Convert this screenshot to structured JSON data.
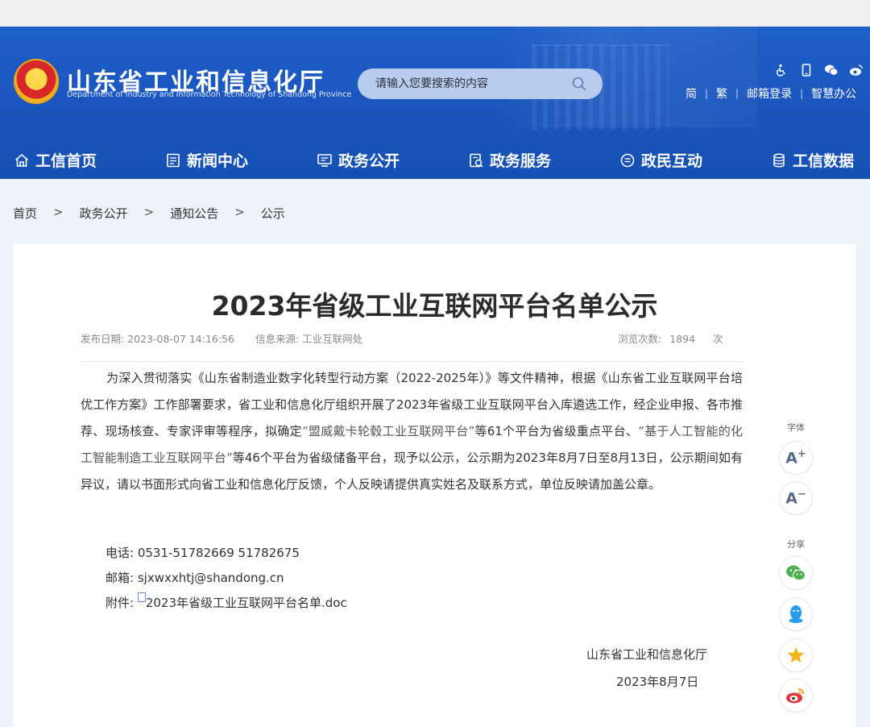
{
  "header": {
    "site_name": "山东省工业和信息化厅",
    "site_name_en": "Department of Industry and Information Technology of Shandong Province",
    "search_placeholder": "请输入您要搜索的内容",
    "links": [
      "简",
      "繁",
      "邮箱登录",
      "智慧办公"
    ],
    "tool_icons": [
      "accessibility-icon",
      "mobile-icon",
      "wechat-icon",
      "weibo-icon"
    ]
  },
  "nav": {
    "items": [
      {
        "label": "工信首页",
        "icon": "home-icon"
      },
      {
        "label": "新闻中心",
        "icon": "news-icon"
      },
      {
        "label": "政务公开",
        "icon": "gov-open-icon"
      },
      {
        "label": "政务服务",
        "icon": "service-icon"
      },
      {
        "label": "政民互动",
        "icon": "interaction-icon"
      },
      {
        "label": "工信数据",
        "icon": "database-icon"
      }
    ]
  },
  "breadcrumb": {
    "items": [
      "首页",
      "政务公开",
      "通知公告",
      "公示"
    ],
    "separator": ">"
  },
  "article": {
    "title": "2023年省级工业互联网平台名单公示",
    "publish_label": "发布日期:",
    "publish_date": "2023-08-07 14:16:56",
    "source_label": "信息来源:",
    "source": "工业互联网处",
    "views_label": "浏览次数:",
    "views": "1894",
    "views_unit": "次",
    "para_a": "为深入贯彻落实《山东省制造业数字化转型行动方案（2022-2025年）》等文件精神，根据《山东省工业互联网平台培优工作方案》工作部署要求，省工业和信息化厅组织开展了2023年省级工业互联网平台入库遴选工作，经企业申报、各市推荐、现场核查、专家评审等程序，拟确定",
    "para_q1": "“盟威戴卡轮毂工业互联网平台”",
    "para_b": "等61个平台为省级重点平台、",
    "para_q2": "“基于人工智能的化工智能制造工业互联网平台”",
    "para_c": "等46个平台为省级储备平台，现予以公示，公示期为2023年8月7日至8月13日，公示期间如有异议，请以书面形式向省工业和信息化厅反馈，个人反映请提供真实姓名及联系方式，单位反映请加盖公章。",
    "phone_label": "电话:",
    "phone": "0531-51782669 51782675",
    "email_label": "邮箱:",
    "email": "sjxwxxhtj@shandong.cn",
    "attach_label": "附件:",
    "attach_name": "2023年省级工业互联网平台名单.doc",
    "sign_org": "山东省工业和信息化厅",
    "sign_date": "2023年8月7日"
  },
  "sidebar": {
    "font_label": "字体",
    "font_increase": "A",
    "font_decrease": "A",
    "share_label": "分享",
    "share_icons": [
      "wechat-share-icon",
      "qq-share-icon",
      "favorite-star-icon",
      "weibo-share-icon"
    ]
  },
  "colors": {
    "header_blue": "#1a55bd",
    "search_bg": "#b8cdee",
    "page_bg": "#eef3fa",
    "wechat_green": "#4cb24c",
    "qq_blue": "#2a9cf0",
    "star_gold": "#f2b416",
    "weibo_red": "#e2383d"
  }
}
